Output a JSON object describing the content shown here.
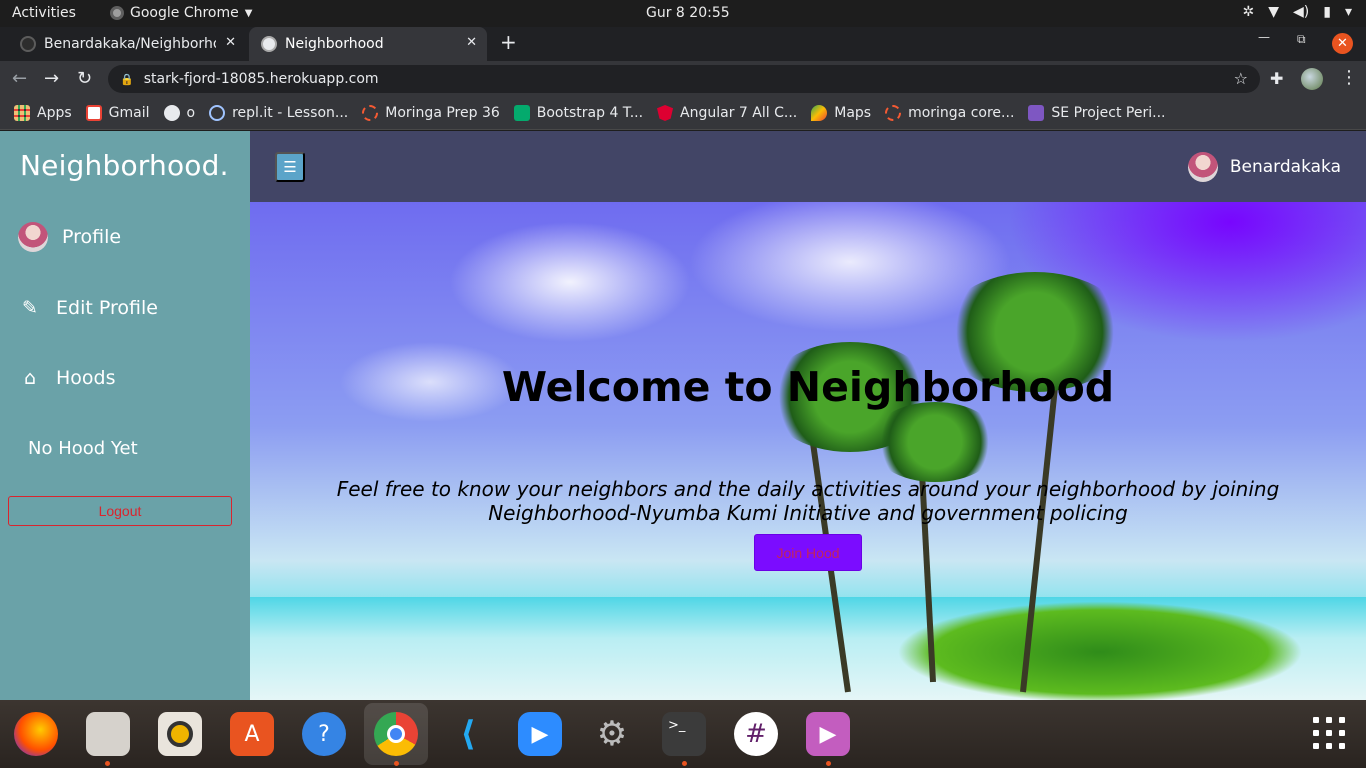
{
  "system": {
    "activities": "Activities",
    "app_name": "Google Chrome",
    "clock": "Gur 8  20:55"
  },
  "browser": {
    "tabs": [
      {
        "title": "Benardakaka/Neighborhood",
        "active": false
      },
      {
        "title": "Neighborhood",
        "active": true
      }
    ],
    "url": "stark-fjord-18085.herokuapp.com",
    "bookmarks": [
      {
        "label": "Apps",
        "icon": "apps-grid-icon"
      },
      {
        "label": "Gmail",
        "icon": "gmail-icon"
      },
      {
        "label": "o",
        "icon": "github-icon"
      },
      {
        "label": "repl.it - Lesson...",
        "icon": "replit-icon"
      },
      {
        "label": "Moringa Prep 36",
        "icon": "moringa-icon"
      },
      {
        "label": "Bootstrap 4 T...",
        "icon": "w3schools-icon"
      },
      {
        "label": "Angular 7 All C...",
        "icon": "angular-icon"
      },
      {
        "label": "Maps",
        "icon": "maps-icon"
      },
      {
        "label": "moringa core...",
        "icon": "moringa-icon"
      },
      {
        "label": "SE Project Peri...",
        "icon": "forms-icon"
      }
    ]
  },
  "site": {
    "brand": "Neighborhood.",
    "sidebar": {
      "profile": "Profile",
      "edit_profile": "Edit Profile",
      "hoods": "Hoods",
      "no_hood": "No Hood Yet",
      "logout": "Logout"
    },
    "header": {
      "username": "Benardakaka"
    },
    "hero": {
      "title": "Welcome to Neighborhood",
      "tagline": "Feel free to know your neighbors and the daily activities around your neighborhood by joining Neighborhood-Nyumba Kumi Initiative and government policing",
      "join_button": "Join Hood"
    },
    "colors": {
      "sidebar_bg": "#6aa2a8",
      "header_bg": "#424566",
      "join_button_bg": "#7b0cff",
      "logout_accent": "#d9252e"
    }
  },
  "dock": {
    "apps": [
      "firefox-icon",
      "files-icon",
      "rhythmbox-icon",
      "software-center-icon",
      "help-icon",
      "chrome-icon",
      "vscode-icon",
      "zoom-icon",
      "settings-icon",
      "terminal-icon",
      "slack-icon",
      "video-player-icon"
    ]
  }
}
